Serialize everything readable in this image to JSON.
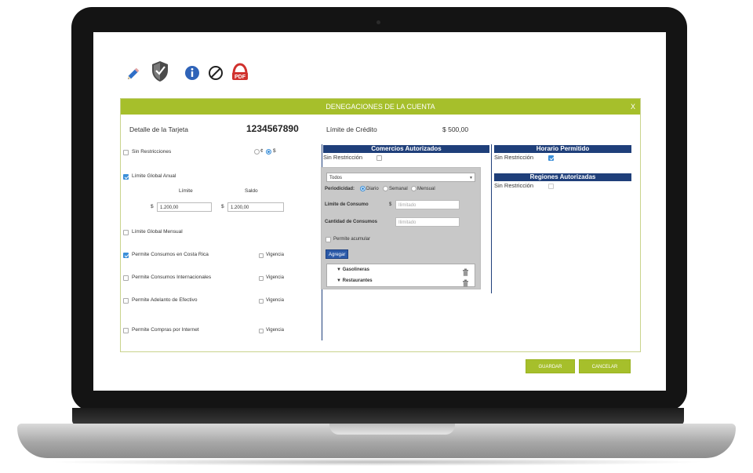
{
  "panel": {
    "title": "DENEGACIONES DE LA CUENTA",
    "close": "X"
  },
  "card": {
    "label": "Detalle de la Tarjeta",
    "number": "1234567890",
    "credit_label": "Límite de Crédito",
    "credit_value": "$ 500,00"
  },
  "currency_toggle": {
    "opt1": "¢",
    "opt2": "$"
  },
  "restrictions": {
    "sin_restricciones": "Sin Restricciones",
    "limite_global_anual": "Límite Global Anual",
    "limite_label": "Límite",
    "saldo_label": "Saldo",
    "currency": "$",
    "limite_value": "1.200,00",
    "saldo_value": "1.200,00",
    "limite_global_mensual": "Límite Global Mensual",
    "costa_rica": "Permite Consumos en Costa Rica",
    "internacionales": "Permite Consumos Internacionales",
    "adelanto": "Permite Adelanto de Efectivo",
    "internet": "Permite Compras por Internet",
    "vigencia": "Vigencia"
  },
  "comercios": {
    "title": "Comercios Autorizados",
    "sin_restriccion": "Sin Restricción",
    "select_value": "Todos",
    "periodicidad_label": "Periodicidad:",
    "diario": "Diario",
    "semanal": "Semanal",
    "mensual": "Mensual",
    "limite_consumo_label": "Límite de Consumo",
    "currency": "$",
    "limite_placeholder": "Ilimitado",
    "cantidad_label": "Cantidad de Consumos",
    "cantidad_placeholder": "Ilimitado",
    "permite_acumular": "Permite acumular",
    "agregar": "Agregar",
    "items": [
      "▼ Gasolineras",
      "▼ Restaurantes"
    ]
  },
  "horario": {
    "title": "Horario Permitido",
    "sin_restriccion": "Sin Restricción"
  },
  "regiones": {
    "title": "Regiones Autorizadas",
    "sin_restriccion": "Sin Restricción"
  },
  "actions": {
    "guardar": "GUARDAR",
    "cancelar": "CANCELAR"
  },
  "colors": {
    "accent_green": "#a6bf2b",
    "section_blue": "#1f3f7a",
    "check_blue": "#3b8fd9",
    "pdf_red": "#d0312d"
  },
  "icons": [
    "pencil-icon",
    "shield-check-icon",
    "info-icon",
    "prohibited-icon",
    "pdf-icon"
  ]
}
